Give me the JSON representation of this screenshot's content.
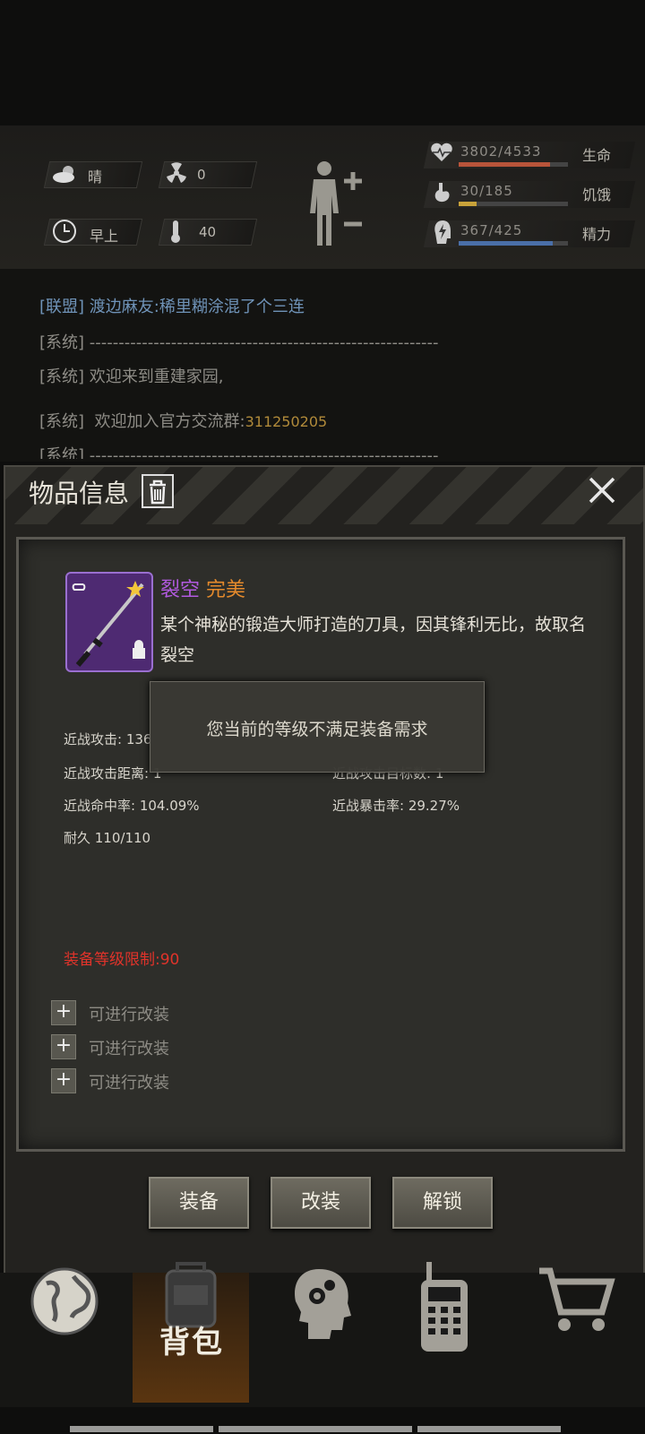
{
  "status": {
    "weather": "晴",
    "radiation": "0",
    "time_of_day": "早上",
    "temperature": "40",
    "health": {
      "value": "3802/4533",
      "label": "生命",
      "ratio": 0.839,
      "color": "#b8543a"
    },
    "hunger": {
      "value": "30/185",
      "label": "饥饿",
      "ratio": 0.162,
      "color": "#c8a23a"
    },
    "energy": {
      "value": "367/425",
      "label": "精力",
      "ratio": 0.864,
      "color": "#4a6fa8"
    }
  },
  "chat": {
    "line1": {
      "tag": "[联盟]",
      "text": "渡边麻友:稀里糊涂混了个三连"
    },
    "line2": {
      "tag": "[系统]",
      "text": "------------------------------------------------------------"
    },
    "line3": {
      "tag": "[系统]",
      "text": "欢迎来到重建家园,"
    },
    "line4": {
      "tag": "[系统]",
      "text": "欢迎加入官方交流群:",
      "group": "311250205"
    },
    "line5": {
      "tag": "[系统]",
      "text": "------------------------------------------------------------"
    }
  },
  "dialog": {
    "title": "物品信息",
    "item": {
      "name": "裂空",
      "quality": "完美",
      "description_line1": "某个神秘的锻造大师打造的刀具，因其锋利无比，故取名",
      "description_line2": "裂空"
    },
    "stats": {
      "melee_attack": "近战攻击: 136",
      "melee_range": "近战攻击距离: 1",
      "melee_count": "近战攻击目标数: 1",
      "melee_hit": "近战命中率: 104.09%",
      "melee_crit": "近战暴击率: 29.27%",
      "durability": "耐久 110/110"
    },
    "level_limit": "装备等级限制:90",
    "mod_slots": [
      "可进行改装",
      "可进行改装",
      "可进行改装"
    ],
    "toast": "您当前的等级不满足装备需求",
    "buttons": {
      "equip": "装备",
      "modify": "改装",
      "unlock": "解锁"
    }
  },
  "nav": {
    "backpack_label": "背包"
  },
  "colors": {
    "purple_name": "#b25ae0",
    "orange_quality": "#e58a2c",
    "red_limit": "#e0332a",
    "group_number": "#b08a3a",
    "ally_text": "#6f93b8"
  }
}
